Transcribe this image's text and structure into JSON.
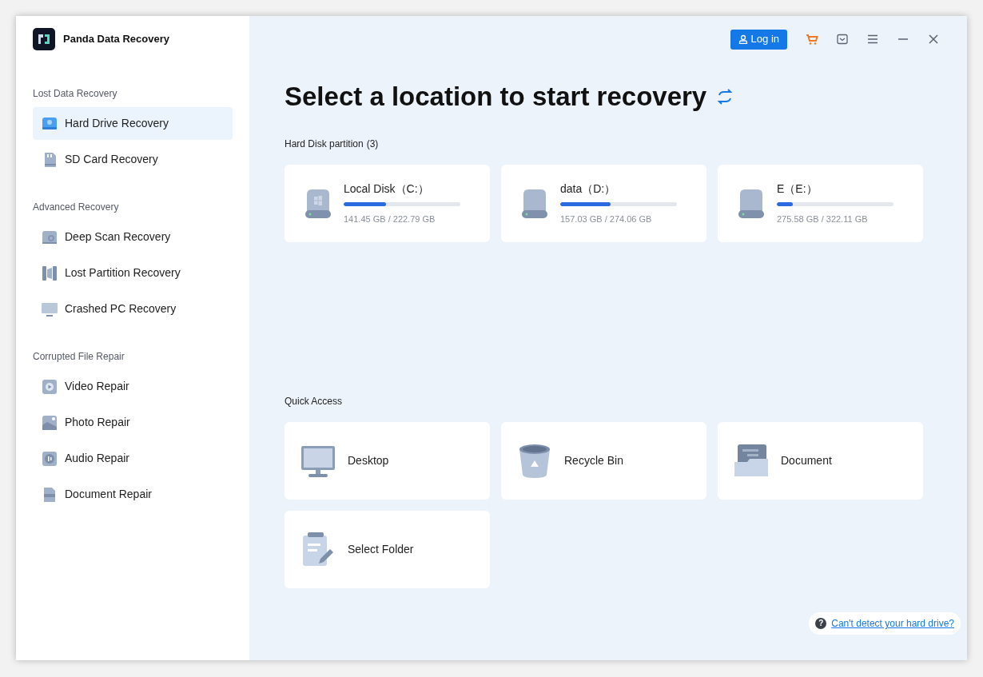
{
  "app": {
    "title": "Panda Data Recovery"
  },
  "sidebar": {
    "sections": [
      {
        "title": "Lost Data Recovery",
        "items": [
          {
            "label": "Hard Drive Recovery",
            "kind": "harddrive",
            "selected": true
          },
          {
            "label": "SD Card Recovery",
            "kind": "sdcard",
            "selected": false
          }
        ]
      },
      {
        "title": "Advanced Recovery",
        "items": [
          {
            "label": "Deep Scan Recovery",
            "kind": "deepscan",
            "selected": false
          },
          {
            "label": "Lost Partition Recovery",
            "kind": "partition",
            "selected": false
          },
          {
            "label": "Crashed PC Recovery",
            "kind": "monitor",
            "selected": false
          }
        ]
      },
      {
        "title": "Corrupted File Repair",
        "items": [
          {
            "label": "Video Repair",
            "kind": "video",
            "selected": false
          },
          {
            "label": "Photo Repair",
            "kind": "photo",
            "selected": false
          },
          {
            "label": "Audio Repair",
            "kind": "audio",
            "selected": false
          },
          {
            "label": "Document Repair",
            "kind": "document",
            "selected": false
          }
        ]
      }
    ]
  },
  "toolbar": {
    "login": "Log in"
  },
  "main": {
    "heading": "Select a location to start recovery",
    "partitions_title": "Hard Disk partition",
    "partitions_count": "(3)",
    "partitions": [
      {
        "name": "Local Disk（C:）",
        "windows": true,
        "level": 0.36,
        "usage": "141.45 GB / 222.79 GB"
      },
      {
        "name": "data（D:）",
        "windows": false,
        "level": 0.43,
        "usage": "157.03 GB / 274.06 GB"
      },
      {
        "name": "E（E:）",
        "windows": false,
        "level": 0.14,
        "usage": "275.58 GB / 322.11 GB"
      }
    ],
    "quick_title": "Quick Access",
    "quick": [
      {
        "label": "Desktop",
        "kind": "desktop"
      },
      {
        "label": "Recycle Bin",
        "kind": "bin"
      },
      {
        "label": "Document",
        "kind": "folder"
      },
      {
        "label": "Select Folder",
        "kind": "select"
      }
    ],
    "help_icon": "?",
    "help_link": "Can't detect your hard drive?"
  }
}
